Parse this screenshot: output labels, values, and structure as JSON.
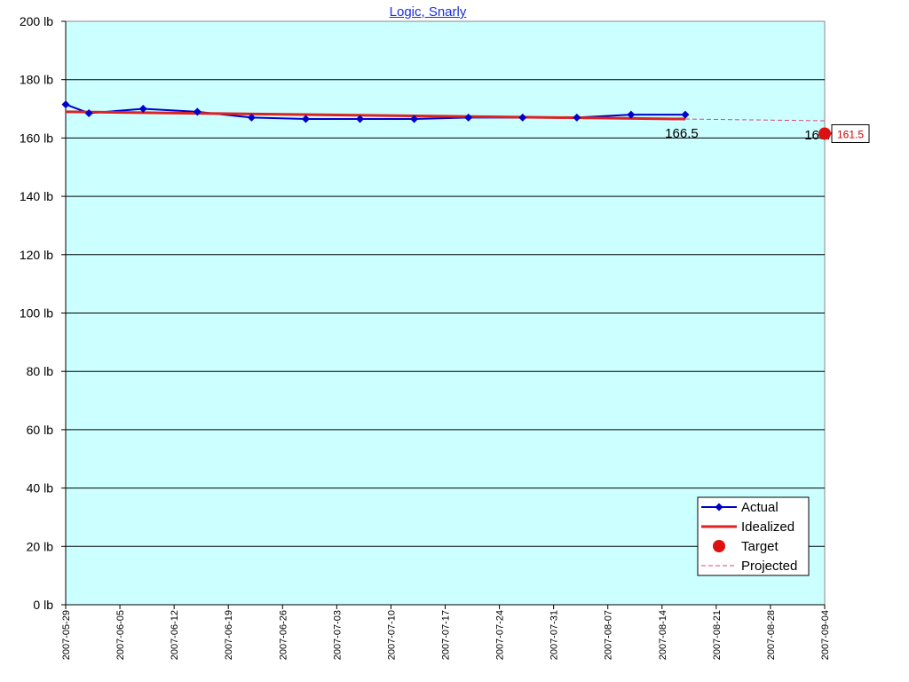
{
  "chart_data": {
    "type": "line",
    "title": "Logic, Snarly",
    "xlabel": "",
    "ylabel": "",
    "ylim": [
      0,
      200
    ],
    "y_unit": "lb",
    "y_ticks": [
      "0 lb",
      "20 lb",
      "40 lb",
      "60 lb",
      "80 lb",
      "100 lb",
      "120 lb",
      "140 lb",
      "160 lb",
      "180 lb",
      "200 lb"
    ],
    "x_range": [
      "2007-05-29",
      "2007-09-04"
    ],
    "x_ticks": [
      "2007-05-29",
      "2007-06-05",
      "2007-06-12",
      "2007-06-19",
      "2007-06-26",
      "2007-07-03",
      "2007-07-10",
      "2007-07-17",
      "2007-07-24",
      "2007-07-31",
      "2007-08-07",
      "2007-08-14",
      "2007-08-21",
      "2007-08-28",
      "2007-09-04"
    ],
    "background_color": "#ccffff",
    "grid": true,
    "legend_position": "bottom-right",
    "series": [
      {
        "name": "Actual",
        "color": "#0000cc",
        "marker": "diamond",
        "x": [
          "2007-05-29",
          "2007-06-01",
          "2007-06-08",
          "2007-06-15",
          "2007-06-22",
          "2007-06-29",
          "2007-07-06",
          "2007-07-13",
          "2007-07-20",
          "2007-07-27",
          "2007-08-03",
          "2007-08-10",
          "2007-08-17"
        ],
        "values": [
          171.5,
          168.5,
          170,
          169,
          167,
          166.5,
          166.5,
          166.5,
          167,
          167,
          167,
          168,
          168
        ]
      },
      {
        "name": "Idealized",
        "color": "#dd2222",
        "x": [
          "2007-05-29",
          "2007-08-17"
        ],
        "values": [
          169,
          166.5
        ]
      },
      {
        "name": "Target",
        "color": "#dd1111",
        "marker": "circle",
        "x": [
          "2007-09-04"
        ],
        "values": [
          161.5
        ]
      },
      {
        "name": "Projected",
        "color": "#dd4477",
        "dashed": true,
        "x": [
          "2007-08-17",
          "2007-09-04"
        ],
        "values": [
          166.5,
          165.9
        ]
      }
    ],
    "annotations": [
      {
        "text": "166.5",
        "x": "2007-08-17",
        "y": 166.5
      },
      {
        "text": "165.9",
        "x": "2007-09-04",
        "y": 165.9
      },
      {
        "text": "161.5",
        "x": "2007-09-04",
        "y": 161.5,
        "boxed": true
      }
    ]
  }
}
